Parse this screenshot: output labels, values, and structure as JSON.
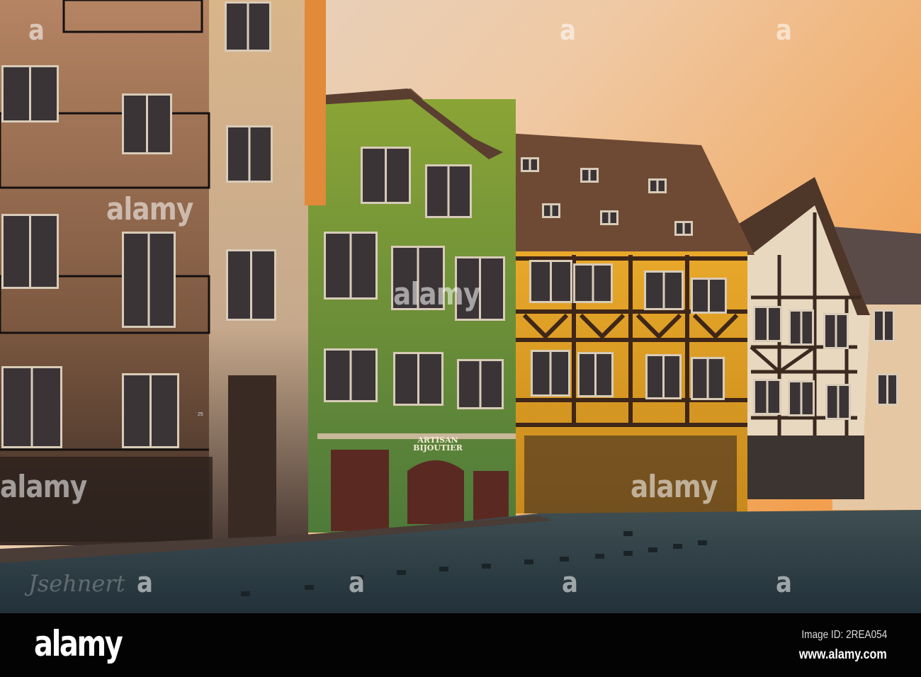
{
  "photo": {
    "shop_sign_line1": "ARTISAN",
    "shop_sign_line2": "BIJOUTIER",
    "house_number": "25",
    "signature": "Jsehnert"
  },
  "watermark": {
    "brand": "alamy",
    "letter": "a"
  },
  "footer": {
    "logo": "alamy",
    "image_id": "Image ID: 2REA054",
    "url": "www.alamy.com"
  },
  "colors": {
    "sky_top": "#e6d6c8",
    "sky_right": "#f2a65e",
    "green_house": "#7d9a2e",
    "yellow_house": "#e0a21c",
    "street": "#2f3f44"
  }
}
